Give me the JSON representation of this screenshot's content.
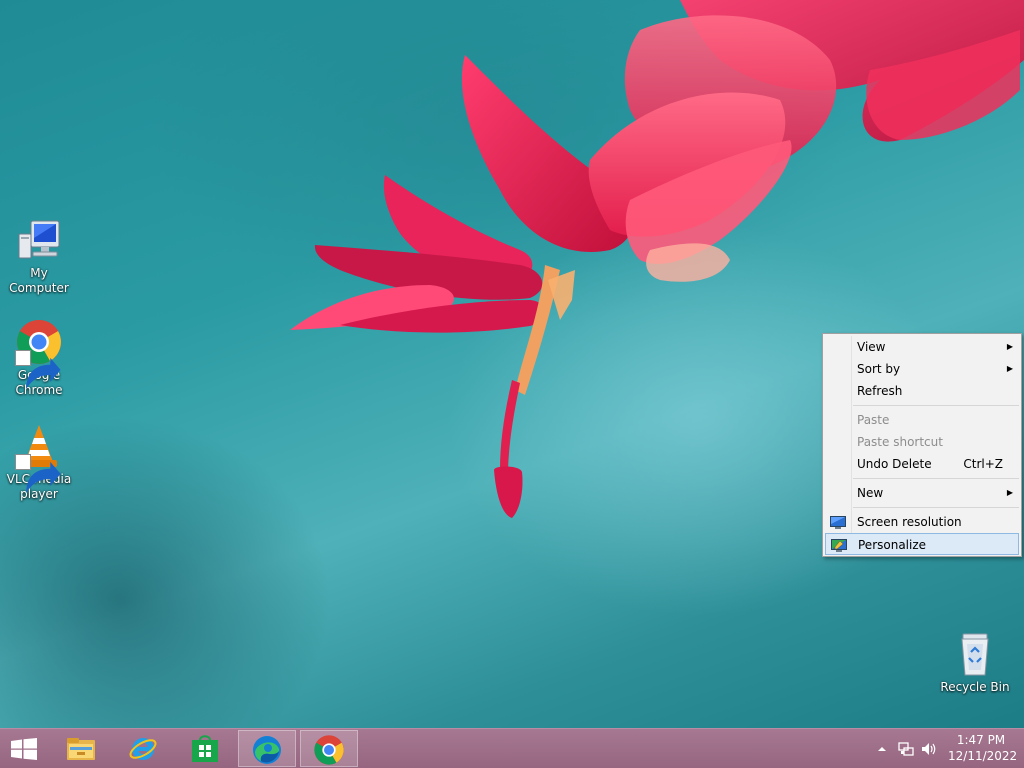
{
  "desktop": {
    "icons": [
      {
        "label": "My Computer"
      },
      {
        "label": "Google Chrome"
      },
      {
        "label": "VLC media player"
      },
      {
        "label": "Recycle Bin"
      }
    ]
  },
  "context_menu": {
    "items": [
      {
        "label": "View",
        "submenu": true
      },
      {
        "label": "Sort by",
        "submenu": true
      },
      {
        "label": "Refresh"
      },
      {
        "label": "Paste",
        "disabled": true
      },
      {
        "label": "Paste shortcut",
        "disabled": true
      },
      {
        "label": "Undo Delete",
        "shortcut": "Ctrl+Z"
      },
      {
        "label": "New",
        "submenu": true
      },
      {
        "label": "Screen resolution",
        "icon": "monitor-icon"
      },
      {
        "label": "Personalize",
        "icon": "personalize-icon",
        "highlighted": true
      }
    ]
  },
  "taskbar": {
    "buttons": [
      {
        "icon": "windows-start-icon"
      },
      {
        "icon": "file-explorer-icon"
      },
      {
        "icon": "internet-explorer-icon"
      },
      {
        "icon": "store-icon"
      },
      {
        "icon": "edge-icon",
        "open": true
      },
      {
        "icon": "chrome-icon",
        "open": true
      }
    ],
    "tray": {
      "icons": [
        "chevron-up-icon",
        "network-icon",
        "volume-icon"
      ],
      "time": "1:47 PM",
      "date": "12/11/2022"
    }
  },
  "colors": {
    "taskbar": "#a0708a",
    "menu_highlight": "#dce9f7",
    "wallpaper": "#2b9ba3"
  }
}
